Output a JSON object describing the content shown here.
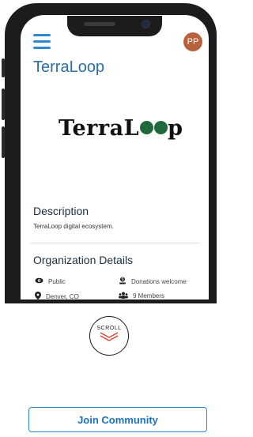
{
  "app": {
    "title": "TerraLoop",
    "avatar_initials": "PP",
    "logo_text_left": "TerraL",
    "logo_text_right": "p"
  },
  "description": {
    "heading": "Description",
    "text": "TerraLoop digital ecosystem."
  },
  "organization": {
    "heading": "Organization Details",
    "visibility": "Public",
    "donations": "Donations welcome",
    "location": "Denver, CO",
    "members": "9 Members"
  },
  "scroll": {
    "label": "SCROLL"
  },
  "actions": {
    "join_label": "Join Community"
  },
  "colors": {
    "accent": "#2b8acd",
    "avatar_bg": "#b8613f"
  },
  "icons": {
    "menu": "hamburger-icon",
    "visibility": "eye-icon",
    "donations": "donation-icon",
    "location": "map-pin-icon",
    "members": "users-icon",
    "scroll": "chevron-down-icon"
  }
}
